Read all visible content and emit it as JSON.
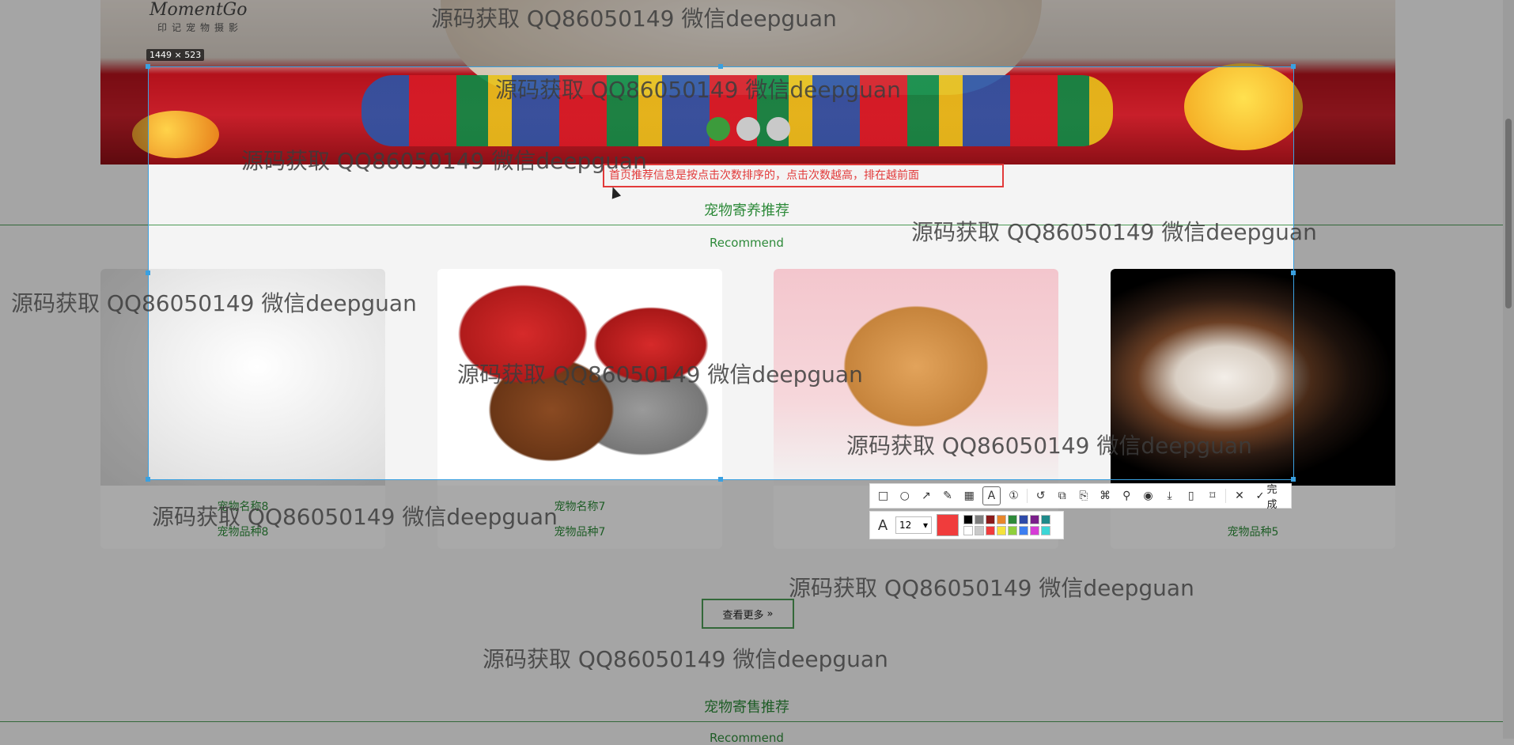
{
  "brand": {
    "logo_text": "MomentGo",
    "logo_sub": "印记宠物摄影"
  },
  "capture": {
    "size_label": "1449 × 523",
    "annotation_text": "首页推荐信息是按点击次数排序的，点击次数越高，排在越前面"
  },
  "sections": [
    {
      "title": "宠物寄养推荐",
      "subtitle": "Recommend"
    },
    {
      "title": "宠物寄售推荐",
      "subtitle": "Recommend"
    }
  ],
  "cards": [
    {
      "name": "宠物名称8",
      "breed": "宠物品种8"
    },
    {
      "name": "宠物名称7",
      "breed": "宠物品种7"
    },
    {
      "name": "",
      "breed": ""
    },
    {
      "name": "",
      "breed": "宠物品种5"
    }
  ],
  "more_button": {
    "label": "查看更多",
    "icon": "double-chevron-right-icon"
  },
  "toolbar": {
    "tools": [
      "rect-icon",
      "circle-icon",
      "arrow-icon",
      "pen-icon",
      "mosaic-icon",
      "text-icon",
      "number-icon",
      "undo-icon",
      "ocr-icon",
      "copy-icon",
      "translate-icon",
      "pin-icon",
      "record-icon",
      "download-icon",
      "long-screenshot-icon",
      "bookmark-icon",
      "close-icon"
    ],
    "done_label": "完成"
  },
  "text_options": {
    "font_size": "12",
    "current_color": "#f03c3c",
    "swatches": [
      "#000000",
      "#7f7f7f",
      "#8b1a1a",
      "#e8862b",
      "#2e8a3a",
      "#2e4aa8",
      "#7a1f8a",
      "#1f8a8a",
      "#ffffff",
      "#c9c9c9",
      "#f03c3c",
      "#f5e23c",
      "#8fcf3c",
      "#3c7ef0",
      "#d63cd6",
      "#3cd6d6"
    ]
  },
  "watermark": "源码获取 QQ86050149 微信deepguan"
}
